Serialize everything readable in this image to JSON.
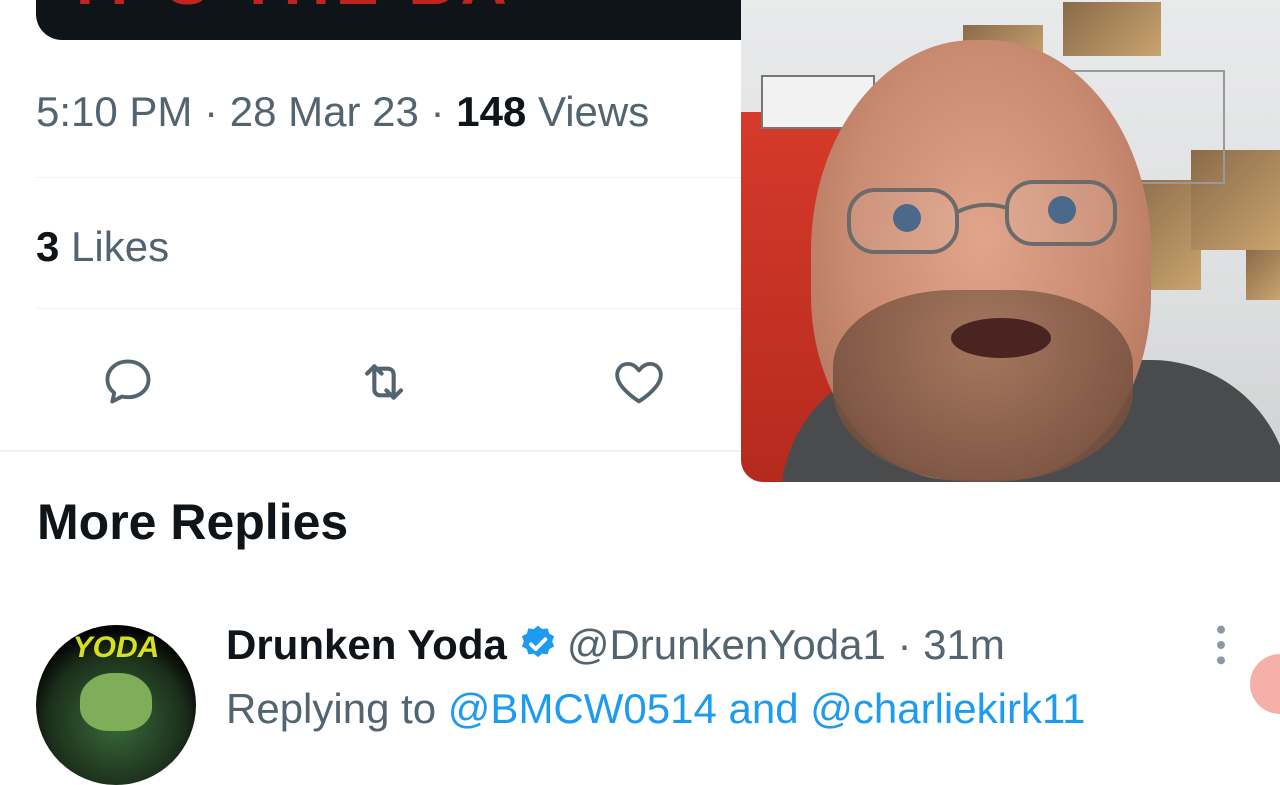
{
  "tweet": {
    "time": "5:10 PM",
    "date": "28 Mar 23",
    "separator": "·",
    "views_count": "148",
    "views_label": "Views",
    "likes_count": "3",
    "likes_label": "Likes"
  },
  "actions": [
    {
      "icon": "reply-icon"
    },
    {
      "icon": "retweet-icon"
    },
    {
      "icon": "heart-icon"
    }
  ],
  "section": {
    "title": "More Replies"
  },
  "reply": {
    "name": "Drunken Yoda",
    "handle": "@DrunkenYoda1",
    "separator": "·",
    "time": "31m",
    "replying_prefix": "Replying to",
    "mention_1": "@BMCW0514",
    "conjunction": "and",
    "mention_2": "@charliekirk11",
    "avatar_text": "YODA"
  },
  "colors": {
    "text_primary": "#0f1419",
    "text_secondary": "#536471",
    "accent": "#1d9bf0",
    "divider": "#eff3f4"
  }
}
